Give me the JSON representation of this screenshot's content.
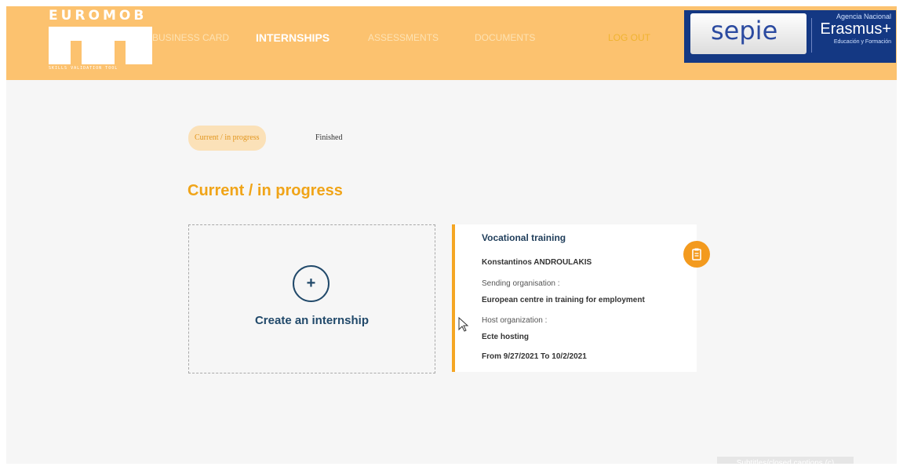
{
  "header": {
    "logo_text": "EUROMOB",
    "logo_tagline": "SKILLS VALIDATION TOOL",
    "nav": [
      {
        "label": "BUSINESS CARD"
      },
      {
        "label": "INTERNSHIPS"
      },
      {
        "label": "ASSESSMENTS"
      },
      {
        "label": "DOCUMENTS"
      },
      {
        "label": "LOG OUT"
      }
    ],
    "sponsor": {
      "name": "sepie",
      "agency": "Agencia Nacional",
      "program": "Erasmus+",
      "sub": "Educación y Formación"
    }
  },
  "tabs": {
    "current": "Current / in progress",
    "finished": "Finished"
  },
  "section_title": "Current / in progress",
  "create_card": {
    "icon_label": "+",
    "label": "Create an internship"
  },
  "internship": {
    "title": "Vocational training",
    "student": "Konstantinos ANDROULAKIS",
    "sending_label": "Sending organisation :",
    "sending_value": "European centre in training for employment",
    "host_label": "Host organization :",
    "host_value": "Ecte hosting",
    "dates": "From 9/27/2021 To 10/2/2021"
  },
  "captions_button": "Subtitles/closed captions (c)",
  "colors": {
    "header": "#fcc26f",
    "accent": "#f0a418",
    "navy": "#21496a"
  }
}
